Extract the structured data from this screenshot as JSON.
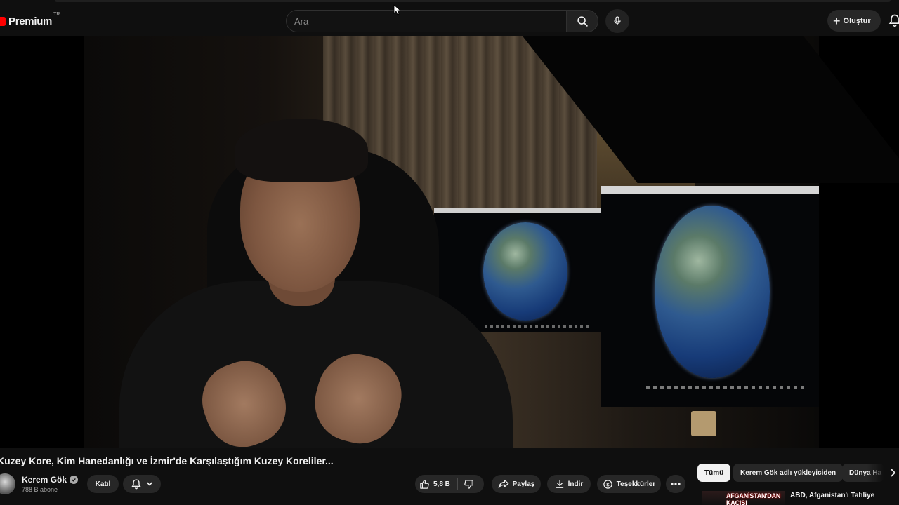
{
  "header": {
    "logo_text": "Premium",
    "logo_country": "TR",
    "search_placeholder": "Ara",
    "create_label": "Oluştur"
  },
  "video": {
    "title": "Kuzey Kore, Kim Hanedanlığı ve İzmir'de Karşılaştığım Kuzey Koreliler...",
    "channel_name": "Kerem Gök",
    "subscribers": "788 B abone",
    "join_label": "Katıl",
    "like_count": "5,8 B",
    "share_label": "Paylaş",
    "download_label": "İndir",
    "thanks_label": "Teşekkürler"
  },
  "chips": [
    {
      "label": "Tümü",
      "active": true
    },
    {
      "label": "Kerem Gök adlı yükleyiciden",
      "active": false
    },
    {
      "label": "Dünya Ha",
      "active": false
    }
  ],
  "recommendation": {
    "thumb_text": "AFGANİSTAN'DAN KAÇIŞ!",
    "title": "ABD, Afganistan'ı Tahliye"
  },
  "colors": {
    "background": "#0f0f0f",
    "brand": "#ff0000",
    "chip_bg": "#272727",
    "text": "#f1f1f1"
  }
}
